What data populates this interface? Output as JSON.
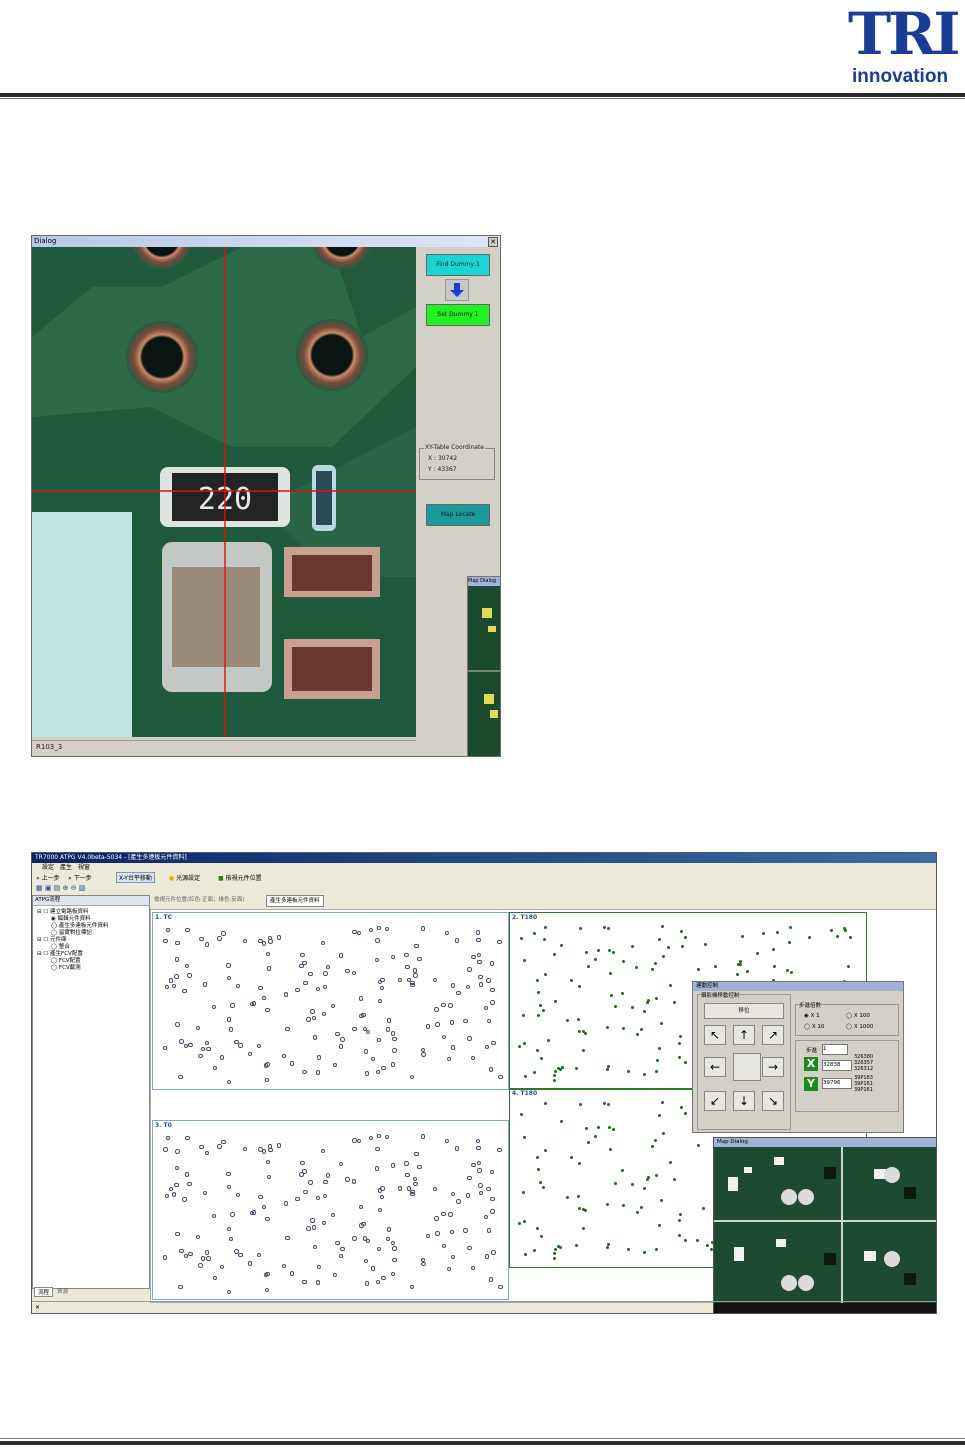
{
  "header": {
    "logo_word": "TRI",
    "logo_sub": "innovation",
    "brand_color": "#1c3d96"
  },
  "dialog1": {
    "title": "Dialog",
    "close_symbol": "✕",
    "find_dummy_label": "Find Dummy 1",
    "set_dummy_label": "Set Dummy 1",
    "map_locate_label": "Map Locate",
    "xy_group_label": "XY-Table Coordinate",
    "x_value": "X : 30742",
    "y_value": "Y : 43367",
    "component_marking": "220",
    "status_text": "R103_3",
    "map_dialog_title": "Map Dialog",
    "find_color": "#19d6d6",
    "set_color": "#22f022",
    "map_color": "#1a9a9a"
  },
  "app": {
    "title": "TR7000 ATPG V4.0beta-5034 - [產生多連板元件資料]",
    "menu_items": [
      "設定",
      "產生",
      "視窗"
    ],
    "toolbar_prev": "上一步",
    "toolbar_next": "下一步",
    "toolbar_xy": "X-Y台平移動",
    "toolbar_light": "光源設定",
    "toolbar_check": "檢視元件位置",
    "tree_title": "ATPG流程",
    "tree_items": [
      "建立電路板資料",
      "編輯元件資料",
      "產生多連板元件資料",
      "留實對位標記",
      "元件庫",
      "整合",
      "產生FCV配置",
      "FCV配置",
      "FCV載測"
    ],
    "bottom_tabs": [
      "流程",
      "資源"
    ],
    "doc_tabs": [
      "檢視元件位置(紅色:正面；綠色:反面)",
      "產生多連板元件資料"
    ],
    "panel_labels": [
      "1. TC",
      "2. T180",
      "3. T0",
      "4. T180"
    ],
    "control_title": "連動控制",
    "control_group": "攝影機移動控制",
    "move_button": "移位",
    "step_group": "步進倍數",
    "step_options": [
      "X 1",
      "X 100",
      "X 10",
      "X 1000"
    ],
    "step_label": "步進",
    "step_value": "1",
    "x_label": "X",
    "y_label": "Y",
    "x_value": "32838",
    "y_value": "39796",
    "x_list": [
      "326380",
      "326357",
      "326312"
    ],
    "y_list": [
      "39P183",
      "39P161",
      "39P161"
    ],
    "map_dialog_title": "Map Dialog",
    "status_symbol": "✕"
  }
}
